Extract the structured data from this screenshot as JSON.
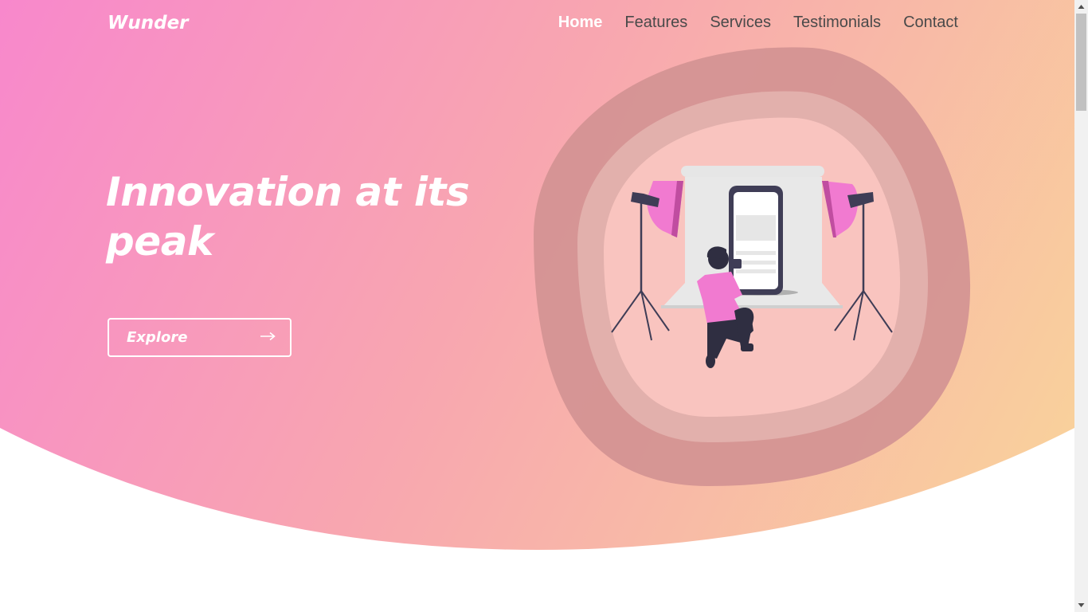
{
  "brand": {
    "name": "Wunder"
  },
  "nav": {
    "items": [
      {
        "label": "Home",
        "active": true
      },
      {
        "label": "Features",
        "active": false
      },
      {
        "label": "Services",
        "active": false
      },
      {
        "label": "Testimonials",
        "active": false
      },
      {
        "label": "Contact",
        "active": false
      }
    ]
  },
  "hero": {
    "headline_line1": "Innovation at its",
    "headline_line2": "peak",
    "button_label": "Explore",
    "button_icon": "arrow-right-icon",
    "illustration": "photographer-photographing-phone-illustration"
  },
  "colors": {
    "gradient_start": "#f889cb",
    "gradient_mid": "#f8aaa8",
    "gradient_end": "#f9cf9a",
    "text_white": "#ffffff",
    "nav_text": "#4a4a4a",
    "blob_outer": "#d39393",
    "blob_inner_ring": "#e1aeaa",
    "blob_center": "#f9c6c1",
    "accent_pink": "#f17ad0",
    "dark_navy": "#2f2e41"
  }
}
